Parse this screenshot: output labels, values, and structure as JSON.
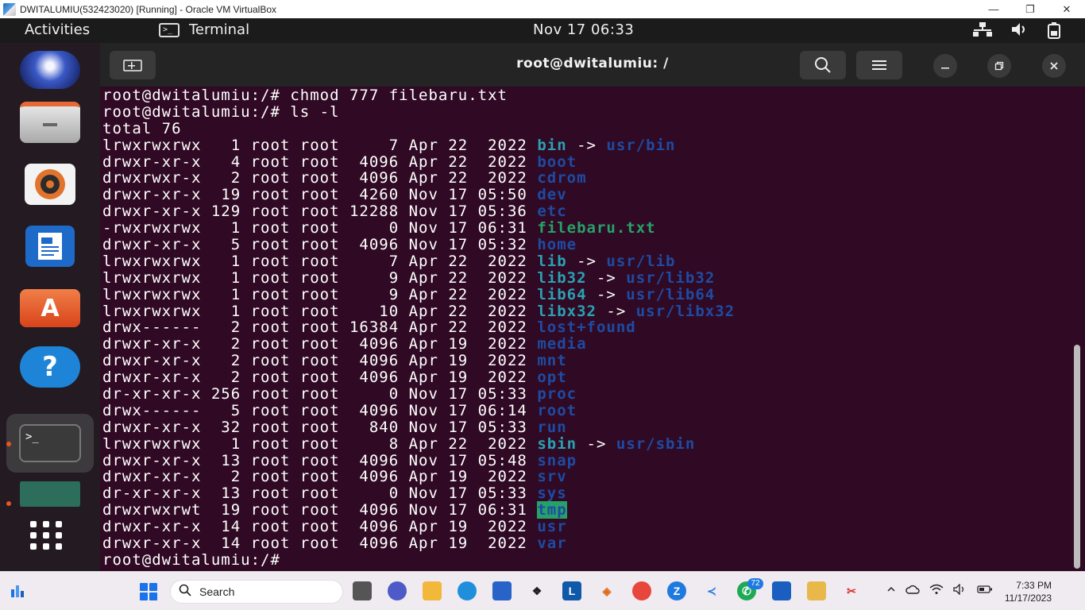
{
  "vbox": {
    "title": "DWITALUMIU(532423020) [Running] - Oracle VM VirtualBox",
    "minimize": "—",
    "restore": "❐",
    "close": "✕"
  },
  "topbar": {
    "activities": "Activities",
    "app_name": "Terminal",
    "clock": "Nov 17  06:33"
  },
  "terminal": {
    "title": "root@dwitalumiu: /",
    "lines": [
      [
        {
          "t": "root@dwitalumiu:/# chmod 777 filebaru.txt"
        }
      ],
      [
        {
          "t": "root@dwitalumiu:/# ls -l"
        }
      ],
      [
        {
          "t": "total 76"
        }
      ],
      [
        {
          "t": "lrwxrwxrwx   1 root root     7 Apr 22  2022 "
        },
        {
          "t": "bin",
          "c": "c-link"
        },
        {
          "t": " -> "
        },
        {
          "t": "usr/bin",
          "c": "c-dir"
        }
      ],
      [
        {
          "t": "drwxr-xr-x   4 root root  4096 Apr 22  2022 "
        },
        {
          "t": "boot",
          "c": "c-dir"
        }
      ],
      [
        {
          "t": "drwxrwxr-x   2 root root  4096 Apr 22  2022 "
        },
        {
          "t": "cdrom",
          "c": "c-dir"
        }
      ],
      [
        {
          "t": "drwxr-xr-x  19 root root  4260 Nov 17 05:50 "
        },
        {
          "t": "dev",
          "c": "c-dir"
        }
      ],
      [
        {
          "t": "drwxr-xr-x 129 root root 12288 Nov 17 05:36 "
        },
        {
          "t": "etc",
          "c": "c-dir"
        }
      ],
      [
        {
          "t": "-rwxrwxrwx   1 root root     0 Nov 17 06:31 "
        },
        {
          "t": "filebaru.txt",
          "c": "c-exec"
        }
      ],
      [
        {
          "t": "drwxr-xr-x   5 root root  4096 Nov 17 05:32 "
        },
        {
          "t": "home",
          "c": "c-dir"
        }
      ],
      [
        {
          "t": "lrwxrwxrwx   1 root root     7 Apr 22  2022 "
        },
        {
          "t": "lib",
          "c": "c-link"
        },
        {
          "t": " -> "
        },
        {
          "t": "usr/lib",
          "c": "c-dir"
        }
      ],
      [
        {
          "t": "lrwxrwxrwx   1 root root     9 Apr 22  2022 "
        },
        {
          "t": "lib32",
          "c": "c-link"
        },
        {
          "t": " -> "
        },
        {
          "t": "usr/lib32",
          "c": "c-dir"
        }
      ],
      [
        {
          "t": "lrwxrwxrwx   1 root root     9 Apr 22  2022 "
        },
        {
          "t": "lib64",
          "c": "c-link"
        },
        {
          "t": " -> "
        },
        {
          "t": "usr/lib64",
          "c": "c-dir"
        }
      ],
      [
        {
          "t": "lrwxrwxrwx   1 root root    10 Apr 22  2022 "
        },
        {
          "t": "libx32",
          "c": "c-link"
        },
        {
          "t": " -> "
        },
        {
          "t": "usr/libx32",
          "c": "c-dir"
        }
      ],
      [
        {
          "t": "drwx------   2 root root 16384 Apr 22  2022 "
        },
        {
          "t": "lost+found",
          "c": "c-dir"
        }
      ],
      [
        {
          "t": "drwxr-xr-x   2 root root  4096 Apr 19  2022 "
        },
        {
          "t": "media",
          "c": "c-dir"
        }
      ],
      [
        {
          "t": "drwxr-xr-x   2 root root  4096 Apr 19  2022 "
        },
        {
          "t": "mnt",
          "c": "c-dir"
        }
      ],
      [
        {
          "t": "drwxr-xr-x   2 root root  4096 Apr 19  2022 "
        },
        {
          "t": "opt",
          "c": "c-dir"
        }
      ],
      [
        {
          "t": "dr-xr-xr-x 256 root root     0 Nov 17 05:33 "
        },
        {
          "t": "proc",
          "c": "c-dir"
        }
      ],
      [
        {
          "t": "drwx------   5 root root  4096 Nov 17 06:14 "
        },
        {
          "t": "root",
          "c": "c-dir"
        }
      ],
      [
        {
          "t": "drwxr-xr-x  32 root root   840 Nov 17 05:33 "
        },
        {
          "t": "run",
          "c": "c-dir"
        }
      ],
      [
        {
          "t": "lrwxrwxrwx   1 root root     8 Apr 22  2022 "
        },
        {
          "t": "sbin",
          "c": "c-link"
        },
        {
          "t": " -> "
        },
        {
          "t": "usr/sbin",
          "c": "c-dir"
        }
      ],
      [
        {
          "t": "drwxr-xr-x  13 root root  4096 Nov 17 05:48 "
        },
        {
          "t": "snap",
          "c": "c-dir"
        }
      ],
      [
        {
          "t": "drwxr-xr-x   2 root root  4096 Apr 19  2022 "
        },
        {
          "t": "srv",
          "c": "c-dir"
        }
      ],
      [
        {
          "t": "dr-xr-xr-x  13 root root     0 Nov 17 05:33 "
        },
        {
          "t": "sys",
          "c": "c-dir"
        }
      ],
      [
        {
          "t": "drwxrwxrwt  19 root root  4096 Nov 17 06:31 "
        },
        {
          "t": "tmp",
          "c": "c-tmp"
        }
      ],
      [
        {
          "t": "drwxr-xr-x  14 root root  4096 Apr 19  2022 "
        },
        {
          "t": "usr",
          "c": "c-dir"
        }
      ],
      [
        {
          "t": "drwxr-xr-x  14 root root  4096 Apr 19  2022 "
        },
        {
          "t": "var",
          "c": "c-dir"
        }
      ],
      [
        {
          "t": "root@dwitalumiu:/# "
        }
      ]
    ]
  },
  "taskbar": {
    "search_label": "Search",
    "whatsapp_badge": "72",
    "time": "7:33 PM",
    "date": "11/17/2023"
  },
  "colors": {
    "terminal_bg": "#300a24",
    "symlink": "#2aa1b3",
    "directory": "#1e4ba3",
    "executable": "#26a269",
    "ubuntu_accent": "#e95420"
  }
}
